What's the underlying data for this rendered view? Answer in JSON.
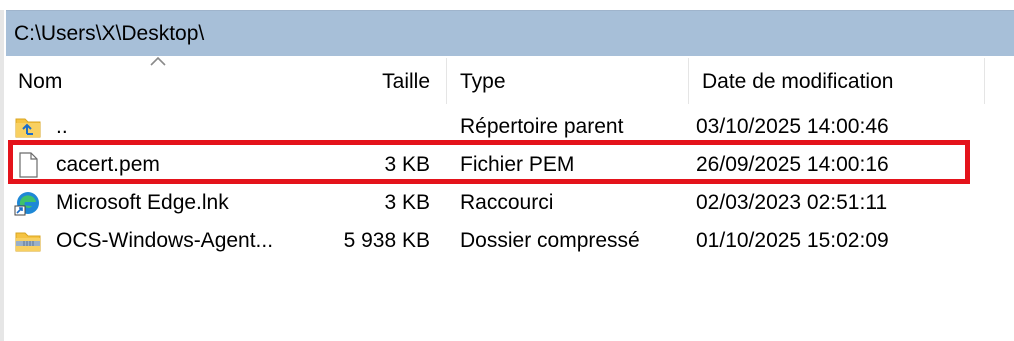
{
  "path": "C:\\Users\\X\\Desktop\\",
  "columns": {
    "name": "Nom",
    "size": "Taille",
    "type": "Type",
    "date": "Date de modification"
  },
  "rows": [
    {
      "icon": "parent-folder-icon",
      "name": "..",
      "size": "",
      "type": "Répertoire parent",
      "date": "03/10/2025 14:00:46"
    },
    {
      "icon": "file-icon",
      "name": "cacert.pem",
      "size": "3 KB",
      "type": "Fichier PEM",
      "date": "26/09/2025 14:00:16"
    },
    {
      "icon": "edge-shortcut-icon",
      "name": "Microsoft Edge.lnk",
      "size": "3 KB",
      "type": "Raccourci",
      "date": "02/03/2023 02:51:11"
    },
    {
      "icon": "zip-folder-icon",
      "name": "OCS-Windows-Agent...",
      "size": "5 938 KB",
      "type": "Dossier compressé",
      "date": "01/10/2025 15:02:09"
    }
  ],
  "colors": {
    "pathbar": "#a7bfd8",
    "highlight": "#e4131b",
    "folder": "#f5c342"
  },
  "highlighted_row": 1
}
